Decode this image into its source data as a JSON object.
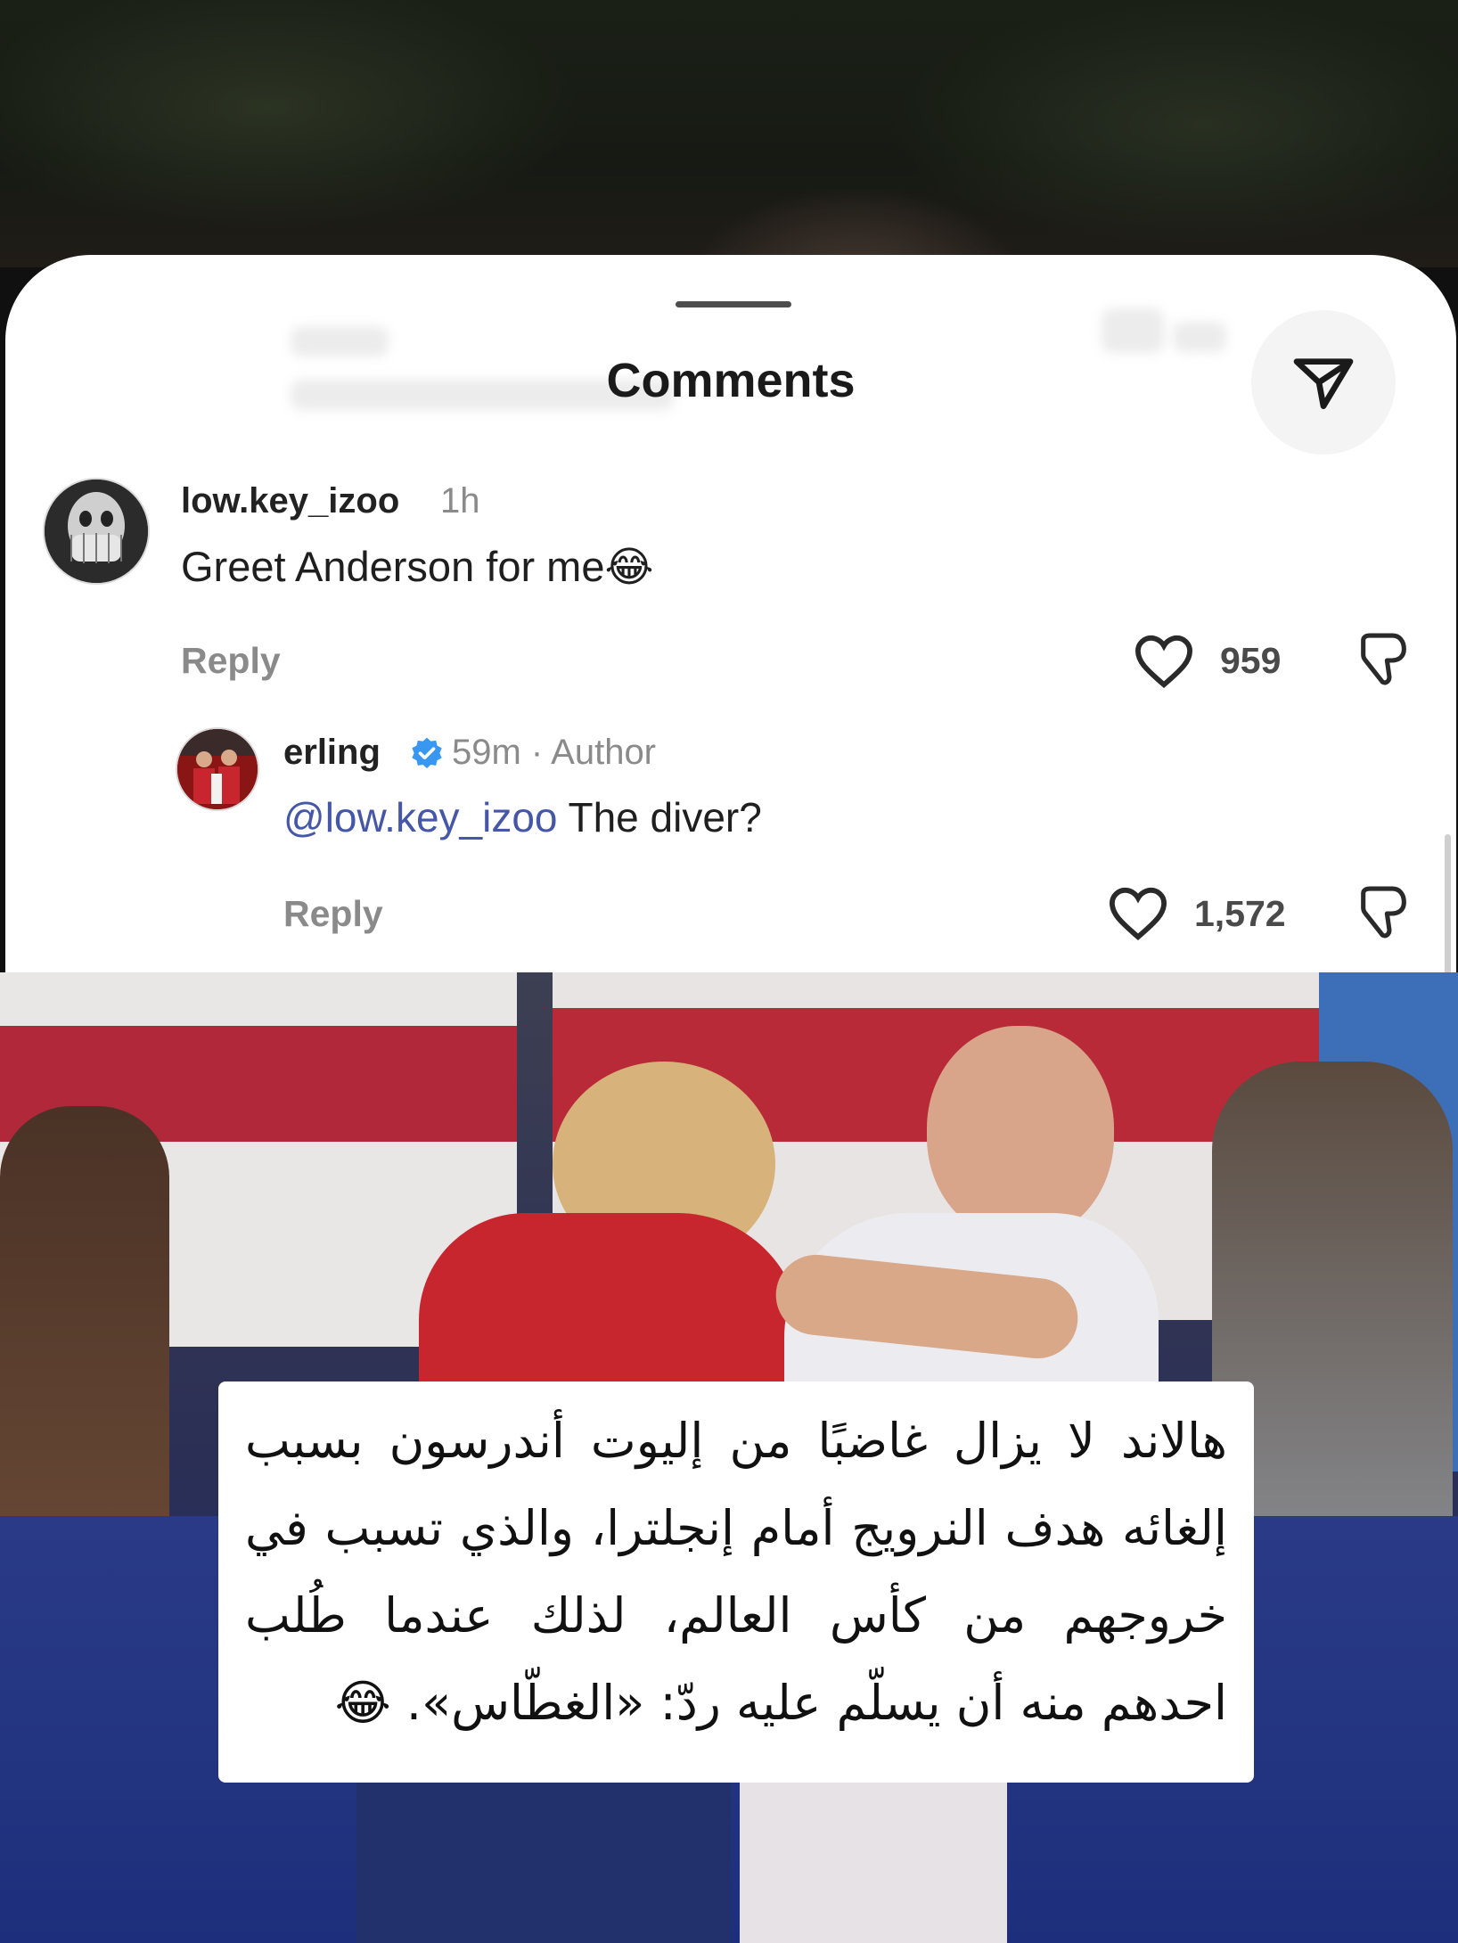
{
  "sheet": {
    "title": "Comments"
  },
  "comments": [
    {
      "username": "low.key_izoo",
      "time": "1h",
      "text": "Greet Anderson for me",
      "emoji": "😂",
      "reply_label": "Reply",
      "likes": "959"
    }
  ],
  "reply": {
    "username": "erling",
    "time_meta": "59m · Author",
    "mention": "@low.key_izoo",
    "text": " The diver?",
    "reply_label": "Reply",
    "likes": "1,572"
  },
  "caption": {
    "text": "هالاند لا يزال غاضبًا من إليوت أندرسون بسبب إلغائه هدف النرويج أمام إنجلترا، والذي تسبب في خروجهم من كأس العالم، لذلك عندما طُلب احدهم منه أن يسلّم عليه ردّ: «الغطّاس». 😂"
  },
  "colors": {
    "verified": "#3897f0",
    "mention": "#4657a8",
    "jersey_red": "#c8262f"
  }
}
